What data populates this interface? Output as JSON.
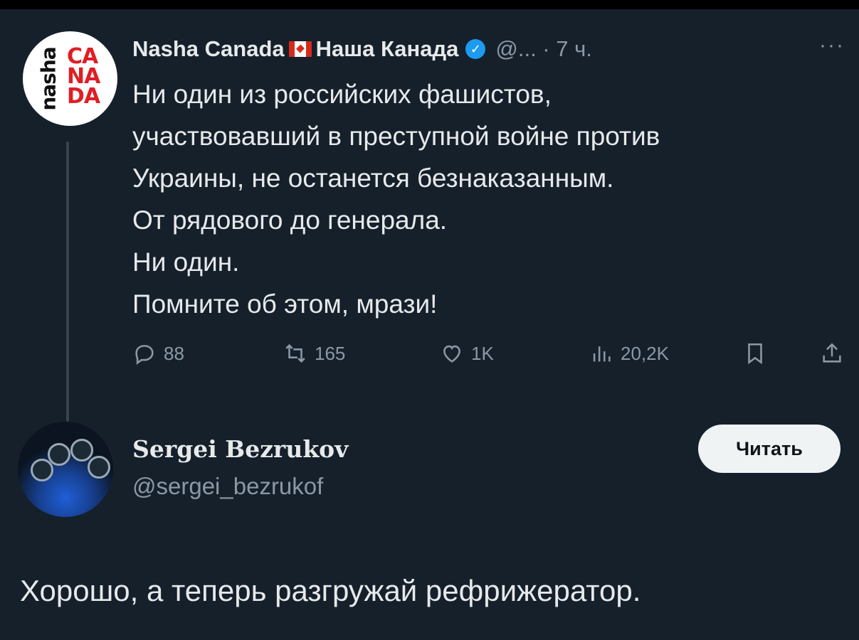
{
  "colors": {
    "background": "#15202b",
    "text_primary": "#e7e9ea",
    "text_secondary": "#8b98a5",
    "verified_blue": "#1d9bf0",
    "canada_red": "#d52b1e",
    "button_bg": "#eff3f4"
  },
  "tweet": {
    "avatar_icon": "nasha-canada-logo",
    "display_name_en": "Nasha Canada",
    "flag_icon": "canada-flag-icon",
    "display_name_ru": "Наша Канада",
    "verified_icon": "verified-badge-icon",
    "handle_time": "@... · 7 ч.",
    "more_icon": "more-icon",
    "text_lines": [
      "Ни один из российских фашистов,",
      "участвовавший в преступной войне против",
      "Украины, не останется безнаказанным.",
      "От рядового до генерала.",
      "Ни один.",
      "Помните об этом, мрази!"
    ],
    "actions": {
      "reply_count": "88",
      "retweet_count": "165",
      "like_count": "1K",
      "views_count": "20,2K"
    }
  },
  "profile_card": {
    "avatar_icon": "motorcycle-dashboard-avatar",
    "name": "Sergei Bezrukov",
    "handle": "@sergei_bezrukof",
    "follow_button": "Читать"
  },
  "caption": "Хорошо, а теперь разгружай рефрижератор."
}
